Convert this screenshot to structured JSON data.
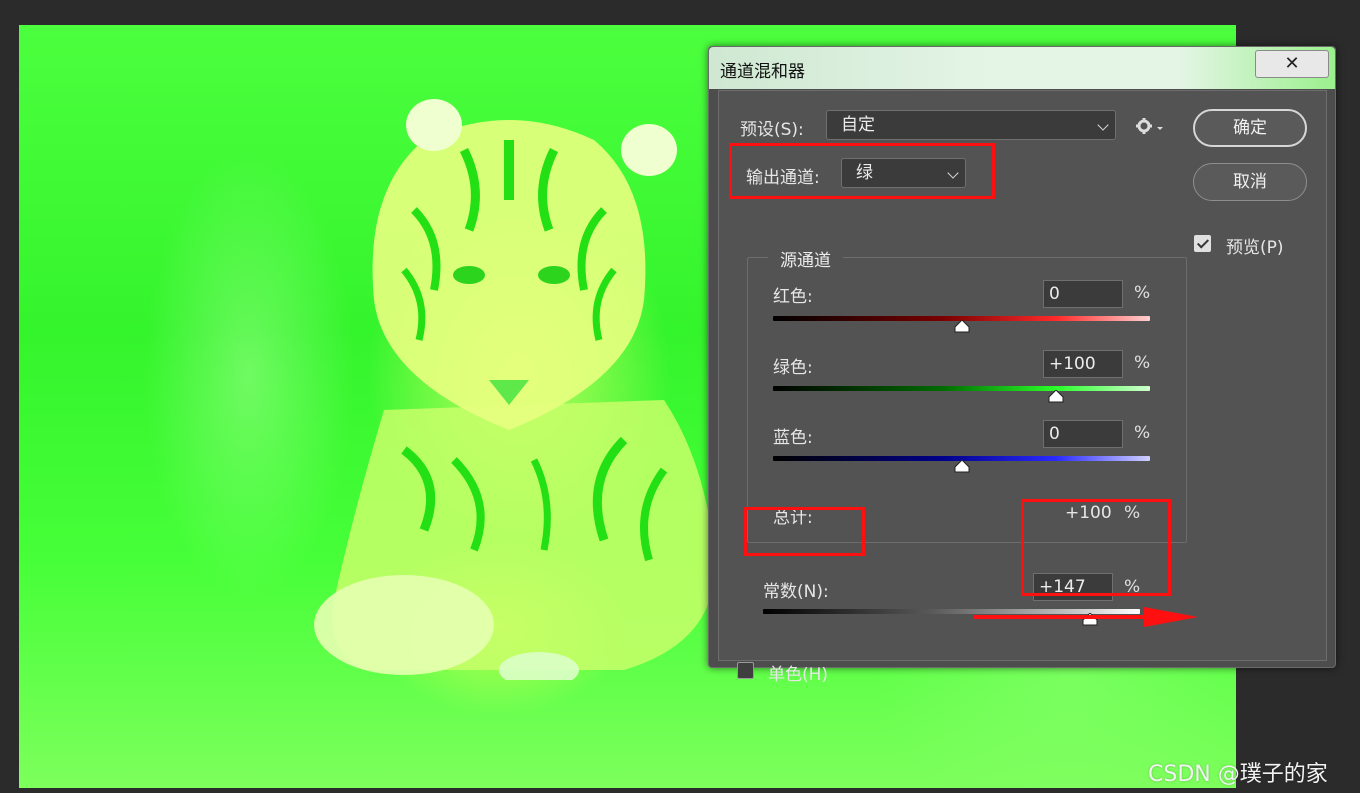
{
  "dialog": {
    "title": "通道混和器",
    "close_label": "✕",
    "preset": {
      "label": "预设(S):",
      "value": "自定"
    },
    "output_channel": {
      "label": "输出通道:",
      "value": "绿"
    },
    "ok_label": "确定",
    "cancel_label": "取消",
    "preview": {
      "label": "预览(P)",
      "checked": true
    },
    "source_group_title": "源通道",
    "channels": [
      {
        "label": "红色:",
        "value": "0",
        "percent": "%",
        "level": 0
      },
      {
        "label": "绿色:",
        "value": "+100",
        "percent": "%",
        "level": 100
      },
      {
        "label": "蓝色:",
        "value": "0",
        "percent": "%",
        "level": 0
      }
    ],
    "total": {
      "label": "总计:",
      "value": "+100",
      "percent": "%"
    },
    "constant": {
      "label": "常数(N):",
      "value": "+147",
      "percent": "%",
      "level": 147
    },
    "monochrome": {
      "label": "单色(H)",
      "checked": false
    }
  },
  "slider_range": {
    "min": -200,
    "max": 200
  },
  "watermark": "CSDN @璞子的家",
  "colors": {
    "annotation_red": "#ff1010",
    "image_green": "#3cf82e"
  }
}
